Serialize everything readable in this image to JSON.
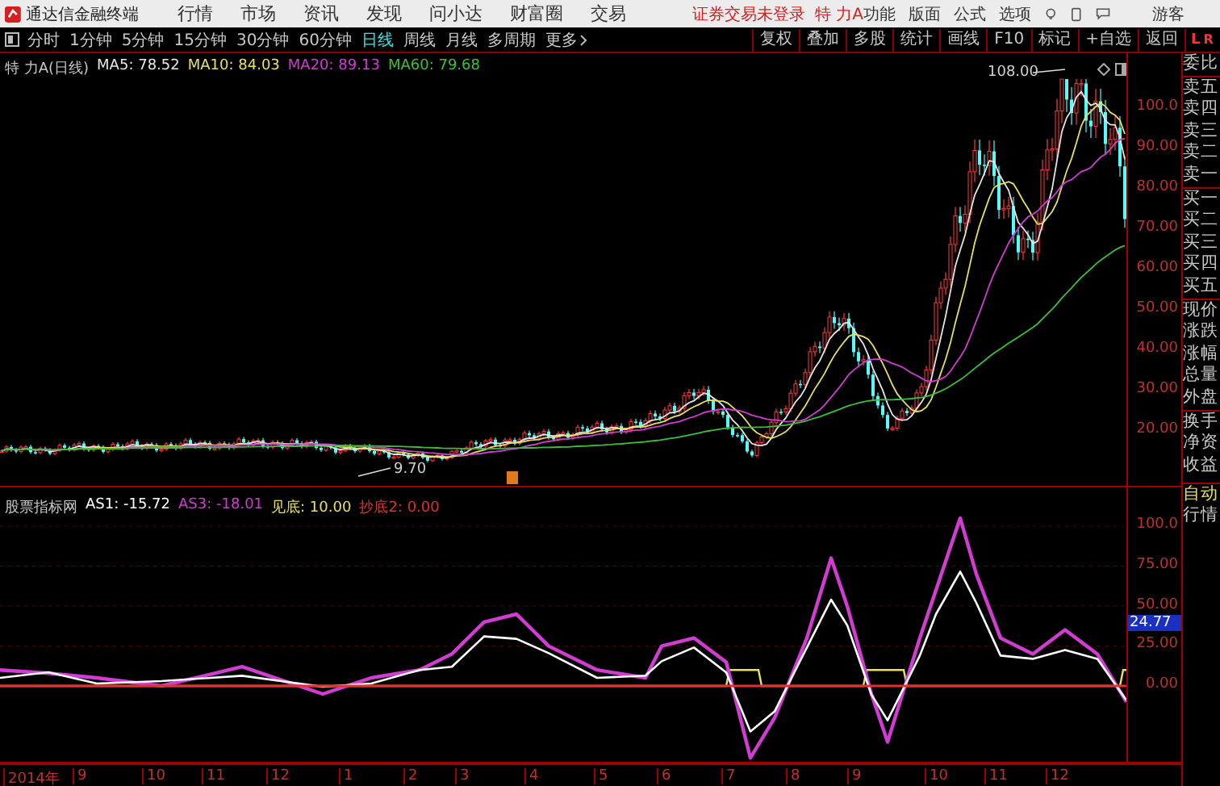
{
  "app": {
    "title": "通达信金融终端",
    "menu": [
      "行情",
      "市场",
      "资讯",
      "发现",
      "问小达",
      "财富圈",
      "交易"
    ],
    "login_status": "证券交易未登录",
    "stock_name": "特 力A",
    "tools": [
      "功能",
      "版面",
      "公式",
      "选项"
    ],
    "user": "游客"
  },
  "toolbar": {
    "periods": [
      {
        "label": "分时",
        "selected": false
      },
      {
        "label": "1分钟",
        "selected": false
      },
      {
        "label": "5分钟",
        "selected": false
      },
      {
        "label": "15分钟",
        "selected": false
      },
      {
        "label": "30分钟",
        "selected": false
      },
      {
        "label": "60分钟",
        "selected": false
      },
      {
        "label": "日线",
        "selected": true
      },
      {
        "label": "周线",
        "selected": false
      },
      {
        "label": "月线",
        "selected": false
      },
      {
        "label": "多周期",
        "selected": false
      }
    ],
    "more": "更多",
    "actions": [
      "复权",
      "叠加",
      "多股",
      "统计",
      "画线",
      "F10",
      "标记",
      "+自选",
      "返回"
    ],
    "side_label": [
      "L",
      "R"
    ]
  },
  "price_pane": {
    "title": "特 力A(日线)",
    "indicators": [
      {
        "label": "MA5: 78.52",
        "color": "#e6e6e6"
      },
      {
        "label": "MA10: 84.03",
        "color": "#e8e060"
      },
      {
        "label": "MA20: 89.13",
        "color": "#d23cd2"
      },
      {
        "label": "MA60: 79.68",
        "color": "#3cc03c"
      }
    ],
    "high_label": "108.00",
    "low_label": "9.70",
    "axis_labels": [
      "100.0",
      "90.00",
      "80.00",
      "70.00",
      "60.00",
      "50.00",
      "40.00",
      "30.00",
      "20.00"
    ]
  },
  "indicator_pane": {
    "title": "股票指标网",
    "lines": [
      {
        "label": "AS1: -15.72",
        "color": "#ffffff"
      },
      {
        "label": "AS3: -18.01",
        "color": "#d23cd2"
      },
      {
        "label": "见底: 10.00",
        "color": "#e8e060"
      },
      {
        "label": "抄底2: 0.00",
        "color": "#e03030"
      }
    ],
    "axis_labels": [
      "100.0",
      "75.00",
      "50.00",
      "25.00",
      "0.00"
    ],
    "current_value": "24.77"
  },
  "date_axis": [
    "2014年",
    "9",
    "10",
    "11",
    "12",
    "1",
    "2",
    "3",
    "4",
    "5",
    "6",
    "7",
    "8",
    "9",
    "10",
    "11",
    "12"
  ],
  "side_panel": {
    "quote_fields": [
      "委比",
      "卖五",
      "卖四",
      "卖三",
      "卖二",
      "卖一",
      "买一",
      "买二",
      "买三",
      "买四",
      "买五",
      "现价",
      "涨跌",
      "涨幅",
      "总量",
      "外盘",
      "换手",
      "净资",
      "收益"
    ],
    "buttons": [
      "自动",
      "行情"
    ]
  }
}
